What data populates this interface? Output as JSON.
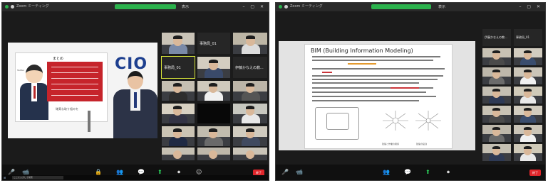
{
  "left_window": {
    "title": "Zoom ミーティング",
    "view_label": "表示",
    "slide": {
      "title": "まとめ",
      "caption": "確実な取り組みを",
      "side_text": "Twitter"
    },
    "backdrop_logo": "CIO",
    "participants": [
      {
        "name": ""
      },
      {
        "name": "事務局_01"
      },
      {
        "name": ""
      },
      {
        "name": "事務局_01"
      },
      {
        "name": ""
      },
      {
        "name": "伊藤かなえの教..."
      },
      {
        "name": ""
      },
      {
        "name": ""
      },
      {
        "name": ""
      }
    ],
    "toolbar": {
      "mute": "🎤",
      "video": "📹",
      "security": "🔒",
      "participants": "👥",
      "chat": "💬",
      "share": "⬆",
      "record": "⏺",
      "reactions": "☺",
      "end": "終了"
    },
    "taskbar_search": "ここに入力して検索"
  },
  "right_window": {
    "title": "Zoom ミーティング",
    "view_label": "表示",
    "slide": {
      "title": "BIM (Building Information Modeling)",
      "caption_left": "建築と作業の関係",
      "caption_right": "建築の役割"
    },
    "participants_top": [
      "伊藤かなえの教...",
      "事務局_01"
    ],
    "toolbar": {
      "mute": "🎤",
      "video": "📹",
      "participants": "👥",
      "chat": "💬",
      "share": "⬆",
      "record": "⏺",
      "end": "終了"
    }
  },
  "colors": {
    "zoom_dark": "#1b1b1b",
    "recording_green": "#2bb24c",
    "end_red": "#e0262b",
    "active_speaker": "#d6e33a",
    "slide_red": "#c6242b"
  }
}
